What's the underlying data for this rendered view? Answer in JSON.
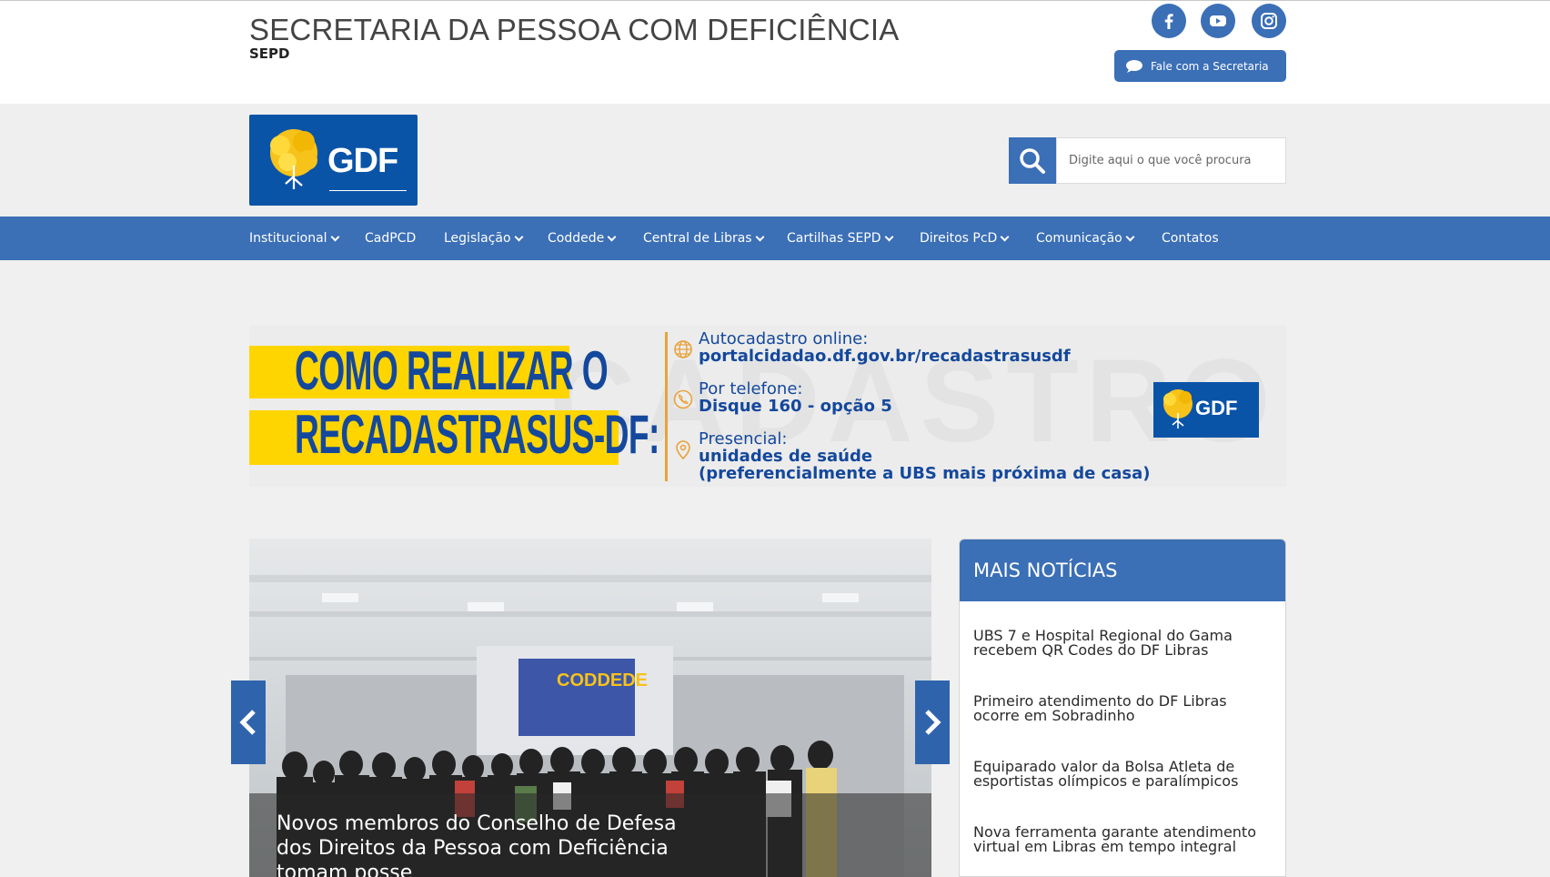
{
  "header": {
    "title": "SECRETARIA DA PESSOA COM DEFICIÊNCIA",
    "subtitle": "SEPD",
    "social": [
      {
        "icon": "facebook-icon"
      },
      {
        "icon": "youtube-icon"
      },
      {
        "icon": "instagram-icon"
      }
    ],
    "contact_label": "Fale com a Secretaria"
  },
  "logo": {
    "text": "GDF"
  },
  "search": {
    "placeholder": "Digite aqui o que você procura"
  },
  "nav": [
    {
      "label": "Institucional",
      "dropdown": true
    },
    {
      "label": "CadPCD",
      "dropdown": false
    },
    {
      "label": "Legislação",
      "dropdown": true
    },
    {
      "label": "Coddede",
      "dropdown": true
    },
    {
      "label": "Central de Libras",
      "dropdown": true
    },
    {
      "label": "Cartilhas SEPD",
      "dropdown": true
    },
    {
      "label": "Direitos PcD",
      "dropdown": true
    },
    {
      "label": "Comunicação",
      "dropdown": true
    },
    {
      "label": "Contatos",
      "dropdown": false
    }
  ],
  "banner": {
    "headline_line1": "COMO REALIZAR O",
    "headline_line2": "RECADASTRASUS-DF:",
    "watermark": "CADASTRO",
    "items": [
      {
        "icon": "globe-icon",
        "label": "Autocadastro online:",
        "value": "portalcidadao.df.gov.br/recadastrasusdf"
      },
      {
        "icon": "phone-icon",
        "label": "Por telefone:",
        "value": "Disque 160 - opção 5"
      },
      {
        "icon": "location-pin-icon",
        "label": "Presencial:",
        "value": "unidades de saúde",
        "value2": "(preferencialmente a UBS mais próxima de casa)"
      }
    ],
    "logo_text": "GDF"
  },
  "slider": {
    "screen_text": "CODDEDE",
    "caption": "Novos membros do Conselho de Defesa dos Direitos da Pessoa com Deficiência tomam posse"
  },
  "news": {
    "title": "MAIS NOTÍCIAS",
    "items": [
      "UBS 7 e Hospital Regional do Gama recebem QR Codes do DF Libras",
      "Primeiro atendimento do DF Libras ocorre em Sobradinho",
      "Equiparado valor da Bolsa Atleta de esportistas olímpicos e paralímpicos",
      "Nova ferramenta garante atendimento virtual em Libras em tempo integral"
    ]
  },
  "colors": {
    "primary_blue": "#3b6fb6",
    "gdf_blue": "#0a54a8",
    "banner_yellow": "#ffd500",
    "banner_text_blue": "#14489c",
    "accent_orange": "#e9a23b"
  }
}
